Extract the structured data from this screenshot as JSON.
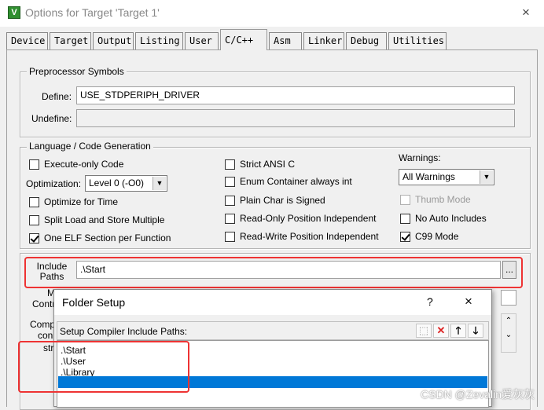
{
  "window": {
    "title": "Options for Target 'Target 1'",
    "app_icon": "keil-uvision-icon",
    "close": "×"
  },
  "tabs": [
    {
      "label": "Device"
    },
    {
      "label": "Target"
    },
    {
      "label": "Output"
    },
    {
      "label": "Listing"
    },
    {
      "label": "User"
    },
    {
      "label": "C/C++",
      "active": true
    },
    {
      "label": "Asm"
    },
    {
      "label": "Linker"
    },
    {
      "label": "Debug"
    },
    {
      "label": "Utilities"
    }
  ],
  "preprocessor": {
    "group_label": "Preprocessor Symbols",
    "define_label": "Define:",
    "define_value": "USE_STDPERIPH_DRIVER",
    "undefine_label": "Undefine:",
    "undefine_value": ""
  },
  "language": {
    "group_label": "Language / Code Generation",
    "execute_only": {
      "label": "Execute-only Code",
      "checked": false
    },
    "optimization_label": "Optimization:",
    "optimization_value": "Level 0 (-O0)",
    "optimize_time": {
      "label": "Optimize for Time",
      "checked": false
    },
    "split_load": {
      "label": "Split Load and Store Multiple",
      "checked": false
    },
    "one_elf": {
      "label": "One ELF Section per Function",
      "checked": true
    },
    "strict_ansi": {
      "label": "Strict ANSI C",
      "checked": false
    },
    "enum_container": {
      "label": "Enum Container always int",
      "checked": false
    },
    "plain_char": {
      "label": "Plain Char is Signed",
      "checked": false
    },
    "ro_pos": {
      "label": "Read-Only Position Independent",
      "checked": false
    },
    "rw_pos": {
      "label": "Read-Write Position Independent",
      "checked": false
    },
    "warnings_label": "Warnings:",
    "warnings_value": "All Warnings",
    "thumb_mode": {
      "label": "Thumb Mode",
      "checked": false,
      "disabled": true
    },
    "no_auto_includes": {
      "label": "No Auto Includes",
      "checked": false
    },
    "c99_mode": {
      "label": "C99 Mode",
      "checked": true
    }
  },
  "include": {
    "label_line1": "Include",
    "label_line2": "Paths",
    "value": ".\\Start",
    "browse_label": "..."
  },
  "partial_labels": {
    "misc_fragment": "M",
    "controls_fragment": "Contr",
    "compiler_fragment": "Comp",
    "control_fragment": "con",
    "string_fragment": "stri"
  },
  "folder_setup": {
    "title": "Folder Setup",
    "help": "?",
    "close": "×",
    "header_label": "Setup Compiler Include Paths:",
    "paths": [
      ".\\Start",
      ".\\User",
      ".\\Library"
    ],
    "toolbar_icons": [
      "new-folder-icon",
      "delete-icon",
      "move-up-icon",
      "move-down-icon"
    ]
  },
  "watermark": "CSDN @Zevalin爱灰灰",
  "colors": {
    "highlight": "#0078d7",
    "annotation": "#e33333"
  }
}
